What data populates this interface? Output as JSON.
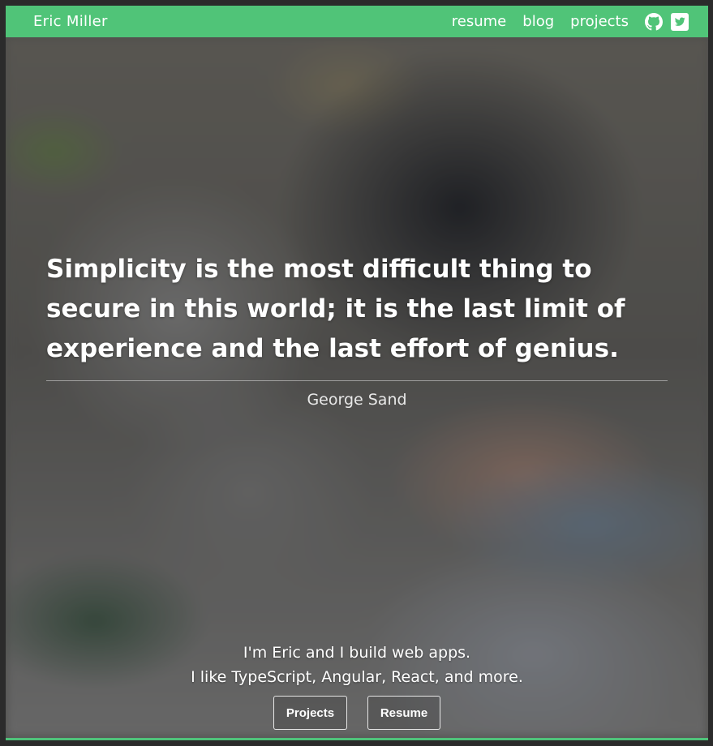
{
  "nav": {
    "brand": "Eric Miller",
    "links": [
      "resume",
      "blog",
      "projects"
    ],
    "icons": [
      "github-icon",
      "twitter-icon"
    ]
  },
  "hero": {
    "quote_lines": [
      "Simplicity is the most difficult thing to",
      "secure in this world; it is the last limit of",
      "experience and the last effort of genius."
    ],
    "author": "George Sand",
    "intro_lines": [
      "I'm Eric and I build web apps.",
      "I like TypeScript, Angular, React, and more."
    ],
    "buttons": [
      "Projects",
      "Resume"
    ]
  },
  "colors": {
    "accent": "#50c478",
    "text": "#ffffff"
  }
}
